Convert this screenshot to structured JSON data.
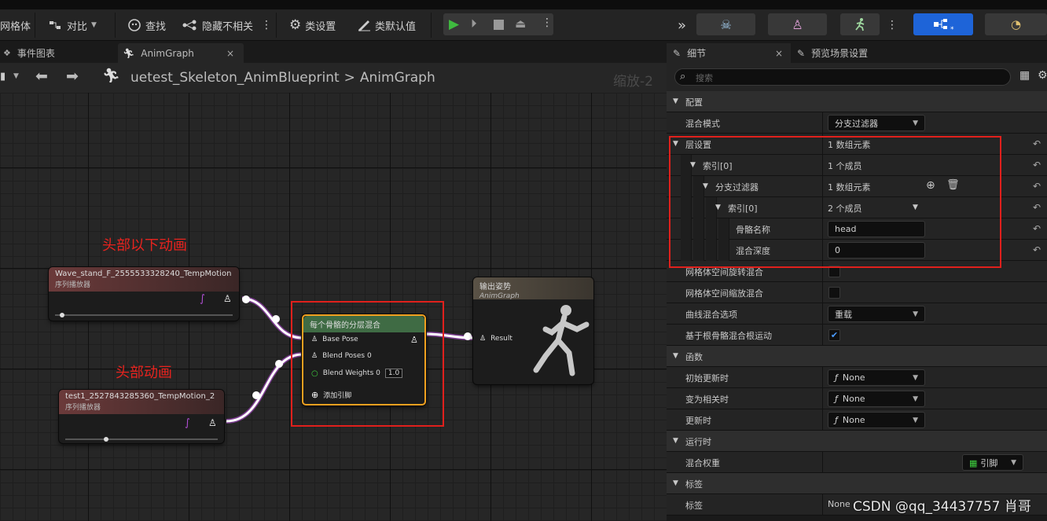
{
  "colors": {
    "accent": "#1e64d8",
    "highlight": "#e0201c",
    "play": "#3fba3f",
    "node_header_green": "#3f6b44",
    "output_border": "#f0a020"
  },
  "toolbar": {
    "mesh_label": "网格体",
    "diff_label": "对比",
    "find_label": "查找",
    "hide_label": "隐藏不相关",
    "class_settings_label": "类设置",
    "class_defaults_label": "类默认值"
  },
  "tabs": {
    "event_graph": "事件图表",
    "anim_graph": "AnimGraph"
  },
  "breadcrumb": {
    "blueprint": "uetest_Skeleton_AnimBlueprint",
    "sep": ">",
    "graph": "AnimGraph",
    "zoom": "缩放-2"
  },
  "annotations": {
    "below_head": "头部以下动画",
    "head": "头部动画"
  },
  "nodes": {
    "wave": {
      "title": "Wave_stand_F_2555533328240_TempMotion",
      "subtitle": "序列播放器"
    },
    "test1": {
      "title": "test1_2527843285360_TempMotion_2",
      "subtitle": "序列播放器"
    },
    "blend": {
      "title": "每个骨骼的分层混合",
      "base_pose": "Base Pose",
      "blend_poses": "Blend Poses 0",
      "blend_weights": "Blend Weights 0",
      "weight_value": "1.0",
      "add_pin": "添加引脚"
    },
    "output": {
      "title": "输出姿势",
      "subtitle": "AnimGraph",
      "result": "Result"
    }
  },
  "panel": {
    "tab_details": "细节",
    "tab_preview": "预览场景设置",
    "search_placeholder": "搜索",
    "rows": [
      {
        "label": "配置",
        "type": "category"
      },
      {
        "label": "混合模式",
        "type": "dropdown",
        "value": "分支过滤器"
      },
      {
        "label": "层设置",
        "type": "text",
        "value": "1 数组元素"
      },
      {
        "label": "索引[0]",
        "type": "text",
        "value": "1 个成员"
      },
      {
        "label": "分支过滤器",
        "type": "text",
        "value": "1 数组元素"
      },
      {
        "label": "索引[0]",
        "type": "text",
        "value": "2 个成员"
      },
      {
        "label": "骨骼名称",
        "type": "input",
        "value": "head"
      },
      {
        "label": "混合深度",
        "type": "input",
        "value": "0"
      },
      {
        "label": "网格体空间旋转混合",
        "type": "checkbox",
        "checked": false
      },
      {
        "label": "网格体空间缩放混合",
        "type": "checkbox",
        "checked": false
      },
      {
        "label": "曲线混合选项",
        "type": "dropdown",
        "value": "重载"
      },
      {
        "label": "基于根骨骼混合根运动",
        "type": "checkbox",
        "checked": true
      },
      {
        "label": "函数",
        "type": "category"
      },
      {
        "label": "初始更新时",
        "type": "func",
        "value": "None"
      },
      {
        "label": "变为相关时",
        "type": "func",
        "value": "None"
      },
      {
        "label": "更新时",
        "type": "func",
        "value": "None"
      },
      {
        "label": "运行时",
        "type": "category"
      },
      {
        "label": "混合权重",
        "type": "pin",
        "value": "引脚"
      },
      {
        "label": "标签",
        "type": "category"
      },
      {
        "label": "标签",
        "type": "text",
        "value": "None"
      }
    ]
  },
  "watermark": "CSDN @qq_34437757 肖哥"
}
